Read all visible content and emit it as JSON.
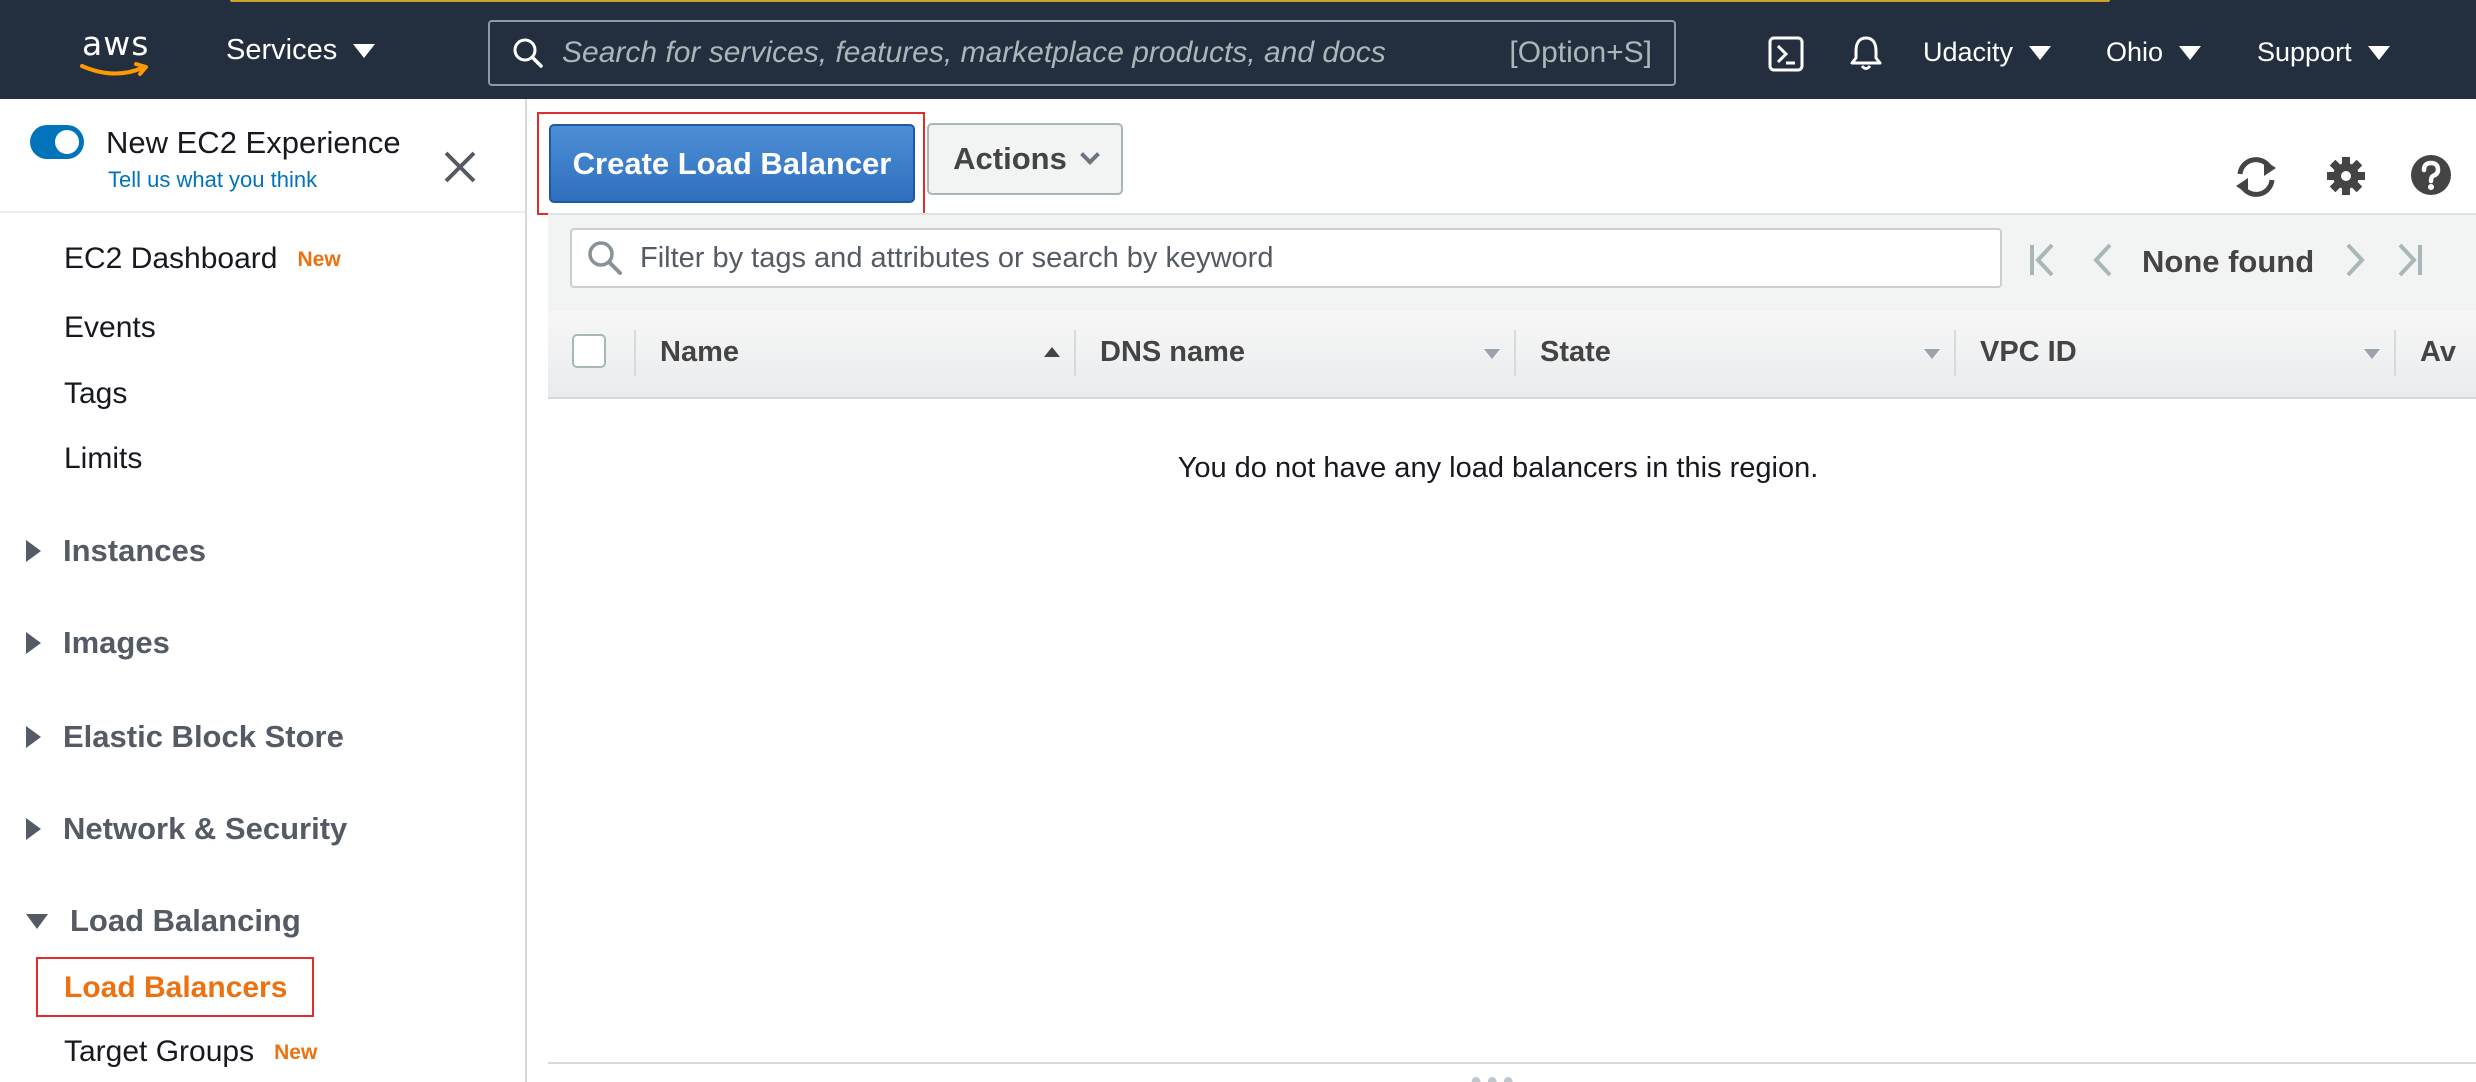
{
  "topnav": {
    "logo_text": "aws",
    "services_label": "Services",
    "search_placeholder": "Search for services, features, marketplace products, and docs",
    "search_shortcut": "[Option+S]",
    "cloudshell_icon": "cloudshell-icon",
    "bell_icon": "bell-icon",
    "account_label": "Udacity",
    "region_label": "Ohio",
    "support_label": "Support"
  },
  "sidebar": {
    "toggle_label": "New EC2 Experience",
    "feedback_link": "Tell us what you think",
    "items": [
      {
        "label": "EC2 Dashboard",
        "badge": "New"
      },
      {
        "label": "Events"
      },
      {
        "label": "Tags"
      },
      {
        "label": "Limits"
      }
    ],
    "sections": [
      {
        "label": "Instances",
        "expanded": false
      },
      {
        "label": "Images",
        "expanded": false
      },
      {
        "label": "Elastic Block Store",
        "expanded": false
      },
      {
        "label": "Network & Security",
        "expanded": false
      },
      {
        "label": "Load Balancing",
        "expanded": true
      }
    ],
    "lb_items": [
      {
        "label": "Load Balancers",
        "active": true
      },
      {
        "label": "Target Groups",
        "badge": "New"
      }
    ]
  },
  "toolbar": {
    "create_label": "Create Load Balancer",
    "actions_label": "Actions"
  },
  "filter": {
    "placeholder": "Filter by tags and attributes or search by keyword",
    "pager_status": "None found"
  },
  "table": {
    "columns": [
      "Name",
      "DNS name",
      "State",
      "VPC ID",
      "Av"
    ],
    "empty_message": "You do not have any load balancers in this region."
  },
  "colors": {
    "nav_bg": "#232f3e",
    "primary_button": "#2f6fbd",
    "active_link": "#ec7211",
    "highlight_border": "#e02d2d"
  }
}
